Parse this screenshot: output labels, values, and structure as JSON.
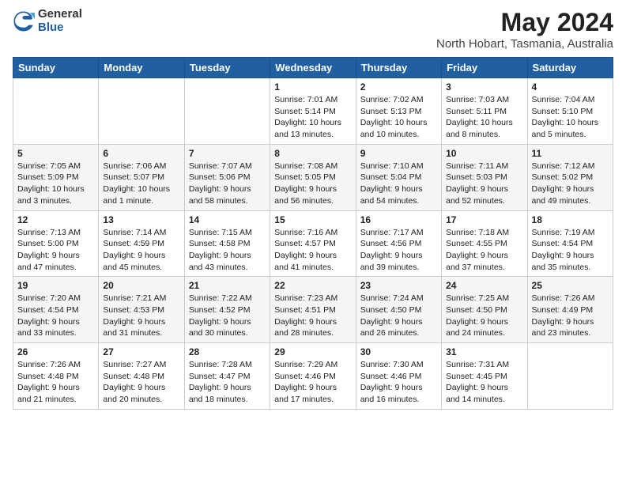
{
  "logo": {
    "general": "General",
    "blue": "Blue"
  },
  "header": {
    "title": "May 2024",
    "subtitle": "North Hobart, Tasmania, Australia"
  },
  "weekdays": [
    "Sunday",
    "Monday",
    "Tuesday",
    "Wednesday",
    "Thursday",
    "Friday",
    "Saturday"
  ],
  "weeks": [
    [
      null,
      null,
      null,
      {
        "day": 1,
        "sunrise": "7:01 AM",
        "sunset": "5:14 PM",
        "daylight": "10 hours and 13 minutes."
      },
      {
        "day": 2,
        "sunrise": "7:02 AM",
        "sunset": "5:13 PM",
        "daylight": "10 hours and 10 minutes."
      },
      {
        "day": 3,
        "sunrise": "7:03 AM",
        "sunset": "5:11 PM",
        "daylight": "10 hours and 8 minutes."
      },
      {
        "day": 4,
        "sunrise": "7:04 AM",
        "sunset": "5:10 PM",
        "daylight": "10 hours and 5 minutes."
      }
    ],
    [
      {
        "day": 5,
        "sunrise": "7:05 AM",
        "sunset": "5:09 PM",
        "daylight": "10 hours and 3 minutes."
      },
      {
        "day": 6,
        "sunrise": "7:06 AM",
        "sunset": "5:07 PM",
        "daylight": "10 hours and 1 minute."
      },
      {
        "day": 7,
        "sunrise": "7:07 AM",
        "sunset": "5:06 PM",
        "daylight": "9 hours and 58 minutes."
      },
      {
        "day": 8,
        "sunrise": "7:08 AM",
        "sunset": "5:05 PM",
        "daylight": "9 hours and 56 minutes."
      },
      {
        "day": 9,
        "sunrise": "7:10 AM",
        "sunset": "5:04 PM",
        "daylight": "9 hours and 54 minutes."
      },
      {
        "day": 10,
        "sunrise": "7:11 AM",
        "sunset": "5:03 PM",
        "daylight": "9 hours and 52 minutes."
      },
      {
        "day": 11,
        "sunrise": "7:12 AM",
        "sunset": "5:02 PM",
        "daylight": "9 hours and 49 minutes."
      }
    ],
    [
      {
        "day": 12,
        "sunrise": "7:13 AM",
        "sunset": "5:00 PM",
        "daylight": "9 hours and 47 minutes."
      },
      {
        "day": 13,
        "sunrise": "7:14 AM",
        "sunset": "4:59 PM",
        "daylight": "9 hours and 45 minutes."
      },
      {
        "day": 14,
        "sunrise": "7:15 AM",
        "sunset": "4:58 PM",
        "daylight": "9 hours and 43 minutes."
      },
      {
        "day": 15,
        "sunrise": "7:16 AM",
        "sunset": "4:57 PM",
        "daylight": "9 hours and 41 minutes."
      },
      {
        "day": 16,
        "sunrise": "7:17 AM",
        "sunset": "4:56 PM",
        "daylight": "9 hours and 39 minutes."
      },
      {
        "day": 17,
        "sunrise": "7:18 AM",
        "sunset": "4:55 PM",
        "daylight": "9 hours and 37 minutes."
      },
      {
        "day": 18,
        "sunrise": "7:19 AM",
        "sunset": "4:54 PM",
        "daylight": "9 hours and 35 minutes."
      }
    ],
    [
      {
        "day": 19,
        "sunrise": "7:20 AM",
        "sunset": "4:54 PM",
        "daylight": "9 hours and 33 minutes."
      },
      {
        "day": 20,
        "sunrise": "7:21 AM",
        "sunset": "4:53 PM",
        "daylight": "9 hours and 31 minutes."
      },
      {
        "day": 21,
        "sunrise": "7:22 AM",
        "sunset": "4:52 PM",
        "daylight": "9 hours and 30 minutes."
      },
      {
        "day": 22,
        "sunrise": "7:23 AM",
        "sunset": "4:51 PM",
        "daylight": "9 hours and 28 minutes."
      },
      {
        "day": 23,
        "sunrise": "7:24 AM",
        "sunset": "4:50 PM",
        "daylight": "9 hours and 26 minutes."
      },
      {
        "day": 24,
        "sunrise": "7:25 AM",
        "sunset": "4:50 PM",
        "daylight": "9 hours and 24 minutes."
      },
      {
        "day": 25,
        "sunrise": "7:26 AM",
        "sunset": "4:49 PM",
        "daylight": "9 hours and 23 minutes."
      }
    ],
    [
      {
        "day": 26,
        "sunrise": "7:26 AM",
        "sunset": "4:48 PM",
        "daylight": "9 hours and 21 minutes."
      },
      {
        "day": 27,
        "sunrise": "7:27 AM",
        "sunset": "4:48 PM",
        "daylight": "9 hours and 20 minutes."
      },
      {
        "day": 28,
        "sunrise": "7:28 AM",
        "sunset": "4:47 PM",
        "daylight": "9 hours and 18 minutes."
      },
      {
        "day": 29,
        "sunrise": "7:29 AM",
        "sunset": "4:46 PM",
        "daylight": "9 hours and 17 minutes."
      },
      {
        "day": 30,
        "sunrise": "7:30 AM",
        "sunset": "4:46 PM",
        "daylight": "9 hours and 16 minutes."
      },
      {
        "day": 31,
        "sunrise": "7:31 AM",
        "sunset": "4:45 PM",
        "daylight": "9 hours and 14 minutes."
      },
      null
    ]
  ]
}
